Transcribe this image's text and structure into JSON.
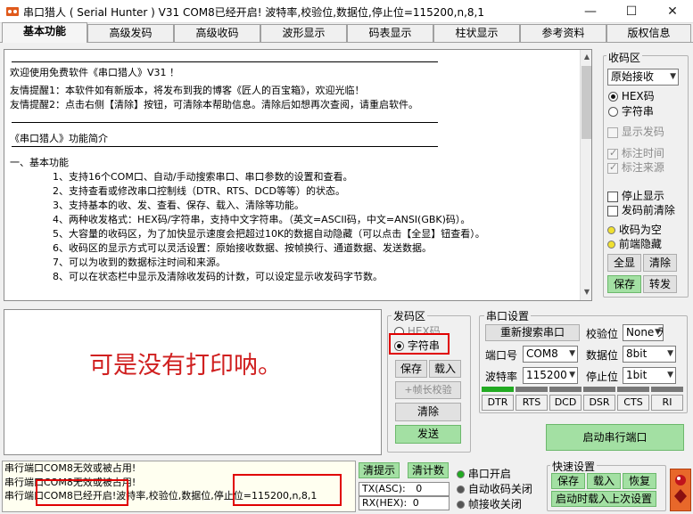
{
  "window": {
    "title": "串口猎人 ( Serial Hunter ) V31    COM8已经开启!  波特率,校验位,数据位,停止位=115200,n,8,1",
    "minimize": "—",
    "maximize": "☐",
    "close": "✕"
  },
  "tabs": [
    "基本功能",
    "高级发码",
    "高级收码",
    "波形显示",
    "码表显示",
    "柱状显示",
    "参考资料",
    "版权信息"
  ],
  "receive_text": {
    "welcome": "欢迎使用免费软件《串口猎人》V31 ！",
    "tip1": "友情提醒1：本软件如有新版本，将发布到我的博客《匠人的百宝箱》，欢迎光临！",
    "tip2": "友情提醒2：点击右侧【清除】按钮，可清除本帮助信息。清除后如想再次查阅，请重启软件。",
    "intro_title": "《串口猎人》功能简介",
    "section1": "一、基本功能",
    "items": [
      "1、支持16个COM口、自动/手动搜索串口、串口参数的设置和查看。",
      "2、支持查看或修改串口控制线（DTR、RTS、DCD等等）的状态。",
      "3、支持基本的收、发、查看、保存、载入、清除等功能。",
      "4、两种收发格式：HEX码/字符串，支持中文字符串。（英文=ASCII码，中文=ANSI(GBK)码）。",
      "5、大容量的收码区，为了加快显示速度会把超过10K的数据自动隐藏（可以点击【全显】钮查看）。",
      "6、收码区的显示方式可以灵活设置：原始接收数据、按帧换行、通道数据、发送数据。",
      "7、可以为收到的数据标注时间和来源。",
      "8、可以在状态栏中显示及清除收发码的计数，可以设定显示收发码字节数。"
    ]
  },
  "recv_panel": {
    "title": "收码区",
    "mode_select": "原始接收",
    "hex_label": "HEX码",
    "string_label": "字符串",
    "show_sent": "显示发码",
    "mark_time": "标注时间",
    "mark_source": "标注来源",
    "stop_display": "停止显示",
    "clear_before_send": "发码前清除",
    "recv_empty": "收码为空",
    "hide_before": "前端隐藏",
    "btn_show_all": "全显",
    "btn_clear": "清除",
    "btn_save": "保存",
    "btn_forward": "转发"
  },
  "send_area_text": "可是没有打印呐。",
  "send_panel": {
    "title": "发码区",
    "hex_label": "HEX码",
    "string_label": "字符串",
    "btn_save": "保存",
    "btn_load": "载入",
    "btn_frame_check": "+帧长校验",
    "btn_clear": "清除",
    "btn_send": "发送"
  },
  "port_panel": {
    "title": "串口设置",
    "btn_search": "重新搜索串口",
    "parity_label": "校验位",
    "parity_value": "None 无",
    "port_label": "端口号",
    "port_value": "COM8",
    "databits_label": "数据位",
    "databits_value": "8bit",
    "baud_label": "波特率",
    "baud_value": "115200",
    "stopbits_label": "停止位",
    "stopbits_value": "1bit",
    "signals": [
      "DTR",
      "RTS",
      "DCD",
      "DSR",
      "CTS",
      "RI"
    ],
    "btn_open": "启动串行端口"
  },
  "status": {
    "log": [
      "串行端口COM8无效或被占用!",
      "串行端口COM8无效或被占用!"
    ],
    "last_a": "串行端口COM8已经开启!",
    "last_b": "波特率,校验位,数据位,",
    "last_c": "停止位=115200,n,8,1",
    "btn_clear_tip": "清提示",
    "btn_clear_count": "清计数",
    "tx_label": "TX(ASC):",
    "tx_value": "0",
    "rx_label": "RX(HEX):",
    "rx_value": "0",
    "ind_open": "串口开启",
    "ind_auto_close": "自动收码关闭",
    "ind_frame_close": "帧接收关闭"
  },
  "quick": {
    "title": "快速设置",
    "btn_save": "保存",
    "btn_load": "载入",
    "btn_restore": "恢复",
    "btn_auto_load": "启动时载入上次设置"
  },
  "colors": {
    "accent_red": "#e00000",
    "green_button": "#a3e0a3",
    "signal_green": "#22aa22"
  }
}
